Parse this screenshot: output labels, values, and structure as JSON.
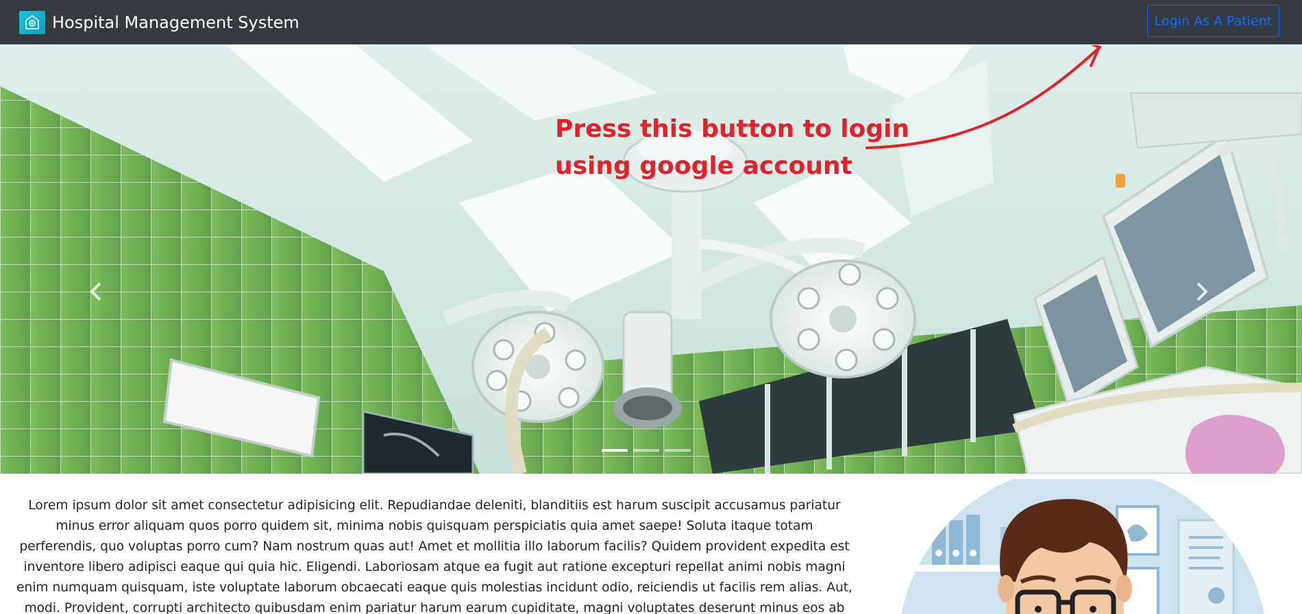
{
  "navbar": {
    "brand_name": "Hospital Management System",
    "login_button_label": "Login As A Patient",
    "background_color": "#343a40",
    "button_color": "#0d6efd"
  },
  "carousel": {
    "slide_count": 3,
    "active_slide": 1,
    "prev_icon": "chevron-left-icon",
    "next_icon": "chevron-right-icon"
  },
  "annotation": {
    "line1": "Press this button to login",
    "line2": "using google account",
    "color": "#e2212b"
  },
  "content": {
    "lorem_text": "Lorem ipsum dolor sit amet consectetur adipisicing elit. Repudiandae deleniti, blanditiis est harum suscipit accusamus pariatur minus error aliquam quos porro quidem sit, minima nobis quisquam perspiciatis quia amet saepe! Soluta itaque totam perferendis, quo voluptas porro cum? Nam nostrum quas aut! Amet et mollitia illo laborum facilis? Quidem provident expedita est inventore libero adipisci eaque qui quia hic. Eligendi. Laboriosam atque ea fugit aut ratione excepturi repellat animi nobis magni enim numquam quisquam, iste voluptate laborum obcaecati eaque quis molestias incidunt odio, reiciendis ut facilis rem alias. Aut, modi. Provident, corrupti architecto quibusdam enim pariatur harum earum cupiditate, magni voluptates deserunt minus eos ab libero quam id praesentium optio! Nemo"
  }
}
